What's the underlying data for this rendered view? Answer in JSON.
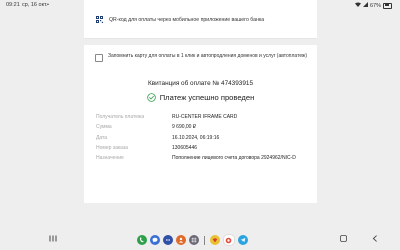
{
  "status_bar": {
    "time": "09:21",
    "date": "ср, 16 окт.",
    "dot": "•",
    "battery": "67%"
  },
  "qr": {
    "text": "QR-код для оплаты через мобильное приложение вашего банка"
  },
  "remember": {
    "text": "Запомнить карту для оплаты в 1 клик и автопродления доменов и услуг (автоплатеж)"
  },
  "receipt": {
    "title": "Квитанция об оплате № 474393915",
    "success": "Платеж успешно проведен",
    "rows": [
      {
        "label": "Получатель платежа",
        "value": "RU-CENTER IFRAME CARD"
      },
      {
        "label": "Сумма",
        "value": "9 690,00 ₽"
      },
      {
        "label": "Дата",
        "value": "16.10.2024, 06:19:16"
      },
      {
        "label": "Номер заказа",
        "value": "130605446"
      },
      {
        "label": "Назначение",
        "value": "Пополнение лицевого счета договора 2924962/NIC-D"
      }
    ]
  },
  "colors": {
    "accent": "#2e9f4a",
    "qr_icon": "#1f3b73"
  },
  "dock": {
    "apps": [
      "phone-icon",
      "messages-icon",
      "chat-icon",
      "contacts-icon",
      "app-grid-icon",
      "yandex-icon",
      "browser-icon",
      "telegram-icon"
    ]
  }
}
